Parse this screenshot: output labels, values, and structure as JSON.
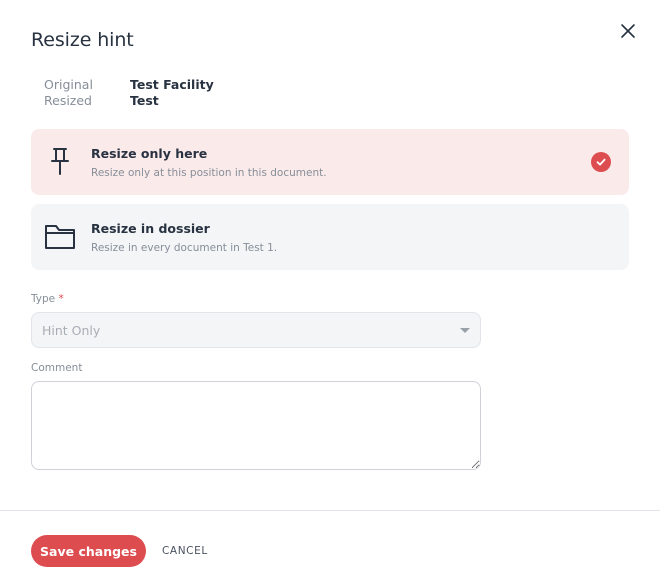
{
  "dialog": {
    "title": "Resize hint",
    "close_icon": "close-icon"
  },
  "info": {
    "original_label": "Original",
    "original_value": "Test Facility",
    "resized_label": "Resized",
    "resized_value": "Test"
  },
  "options": [
    {
      "title": "Resize only here",
      "description": "Resize only at this position in this document.",
      "icon": "pin-icon",
      "selected": true
    },
    {
      "title": "Resize in dossier",
      "description": "Resize in every document in Test 1.",
      "icon": "folder-icon",
      "selected": false
    }
  ],
  "type_field": {
    "label": "Type",
    "required_mark": "*",
    "value": "Hint Only"
  },
  "comment_field": {
    "label": "Comment",
    "value": "",
    "placeholder": ""
  },
  "footer": {
    "save_label": "Save changes",
    "cancel_label": "CANCEL"
  },
  "colors": {
    "accent": "#dd4d50",
    "selected_bg": "#fbeaea",
    "unselected_bg": "#f4f5f7",
    "text": "#283241",
    "muted": "#868e99"
  }
}
